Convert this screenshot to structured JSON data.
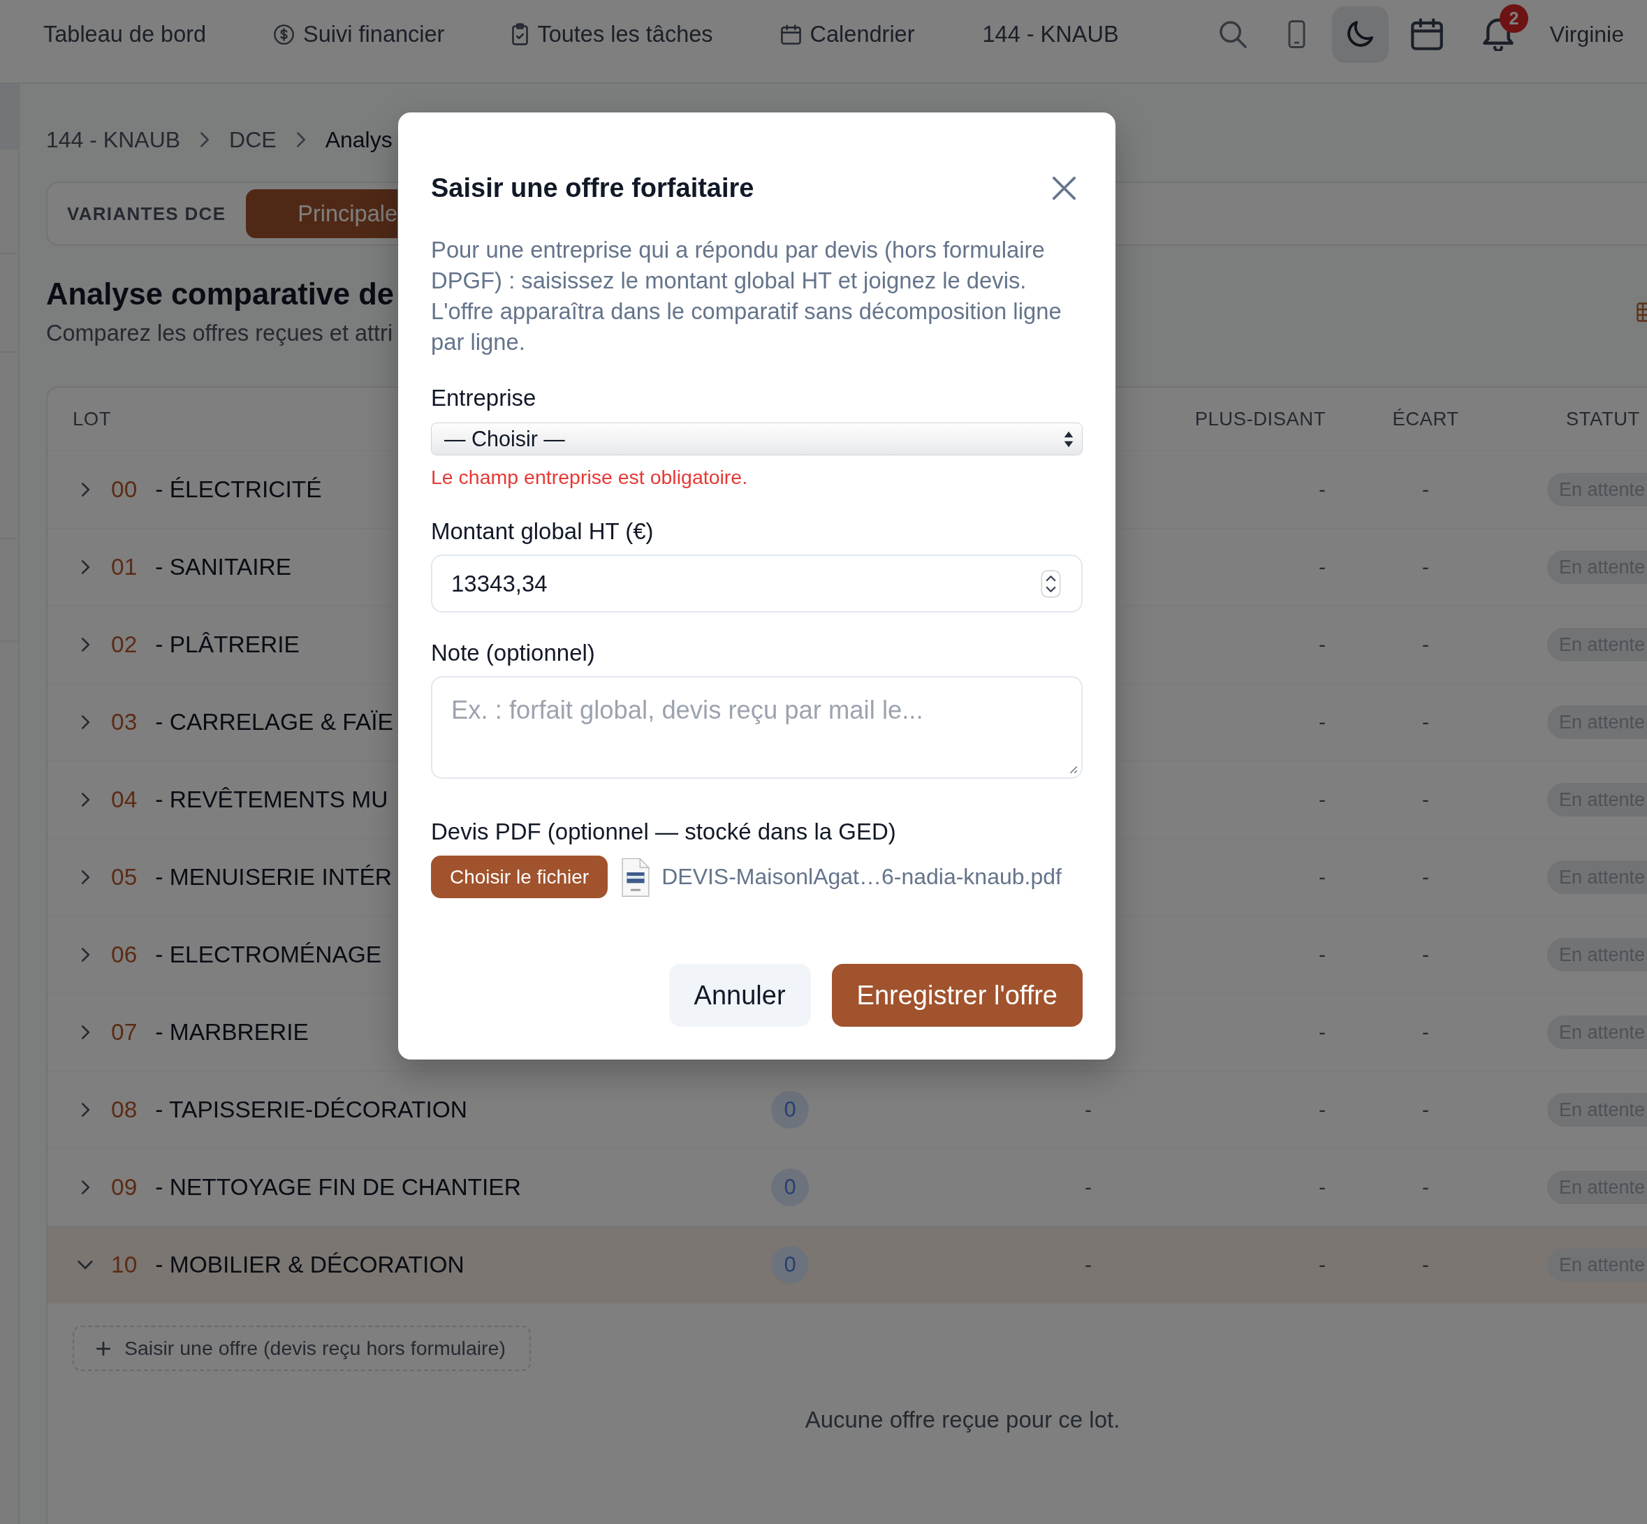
{
  "nav": {
    "home": "Tableau de bord",
    "finance": "Suivi financier",
    "tasks": "Toutes les tâches",
    "calendar": "Calendrier",
    "project": "144 - KNAUB"
  },
  "header_tools": {
    "theme_button": {
      "active": true
    },
    "notification_count": "2",
    "user_name": "Virginie"
  },
  "breadcrumb": [
    {
      "label": "144 - KNAUB",
      "current": false
    },
    {
      "label": "DCE",
      "current": false
    },
    {
      "label": "Analys",
      "current": true
    }
  ],
  "variants": {
    "label": "VARIANTES DCE",
    "tabs": [
      {
        "label": "Principale",
        "selected": true
      }
    ]
  },
  "page": {
    "title": "Analyse comparative de",
    "subtitle": "Comparez les offres reçues et attri"
  },
  "table": {
    "headers": {
      "lot": "LOT",
      "plus_disant": "PLUS-DISANT",
      "ecart": "ÉCART",
      "statut": "STATUT"
    },
    "rows": [
      {
        "number": "00",
        "name": "- ÉLECTRICITÉ",
        "expanded": false,
        "plus_disant": "-",
        "ecart": "-",
        "statut": "En attente"
      },
      {
        "number": "01",
        "name": "- SANITAIRE",
        "expanded": false,
        "plus_disant": "-",
        "ecart": "-",
        "statut": "En attente"
      },
      {
        "number": "02",
        "name": "- PLÂTRERIE",
        "expanded": false,
        "plus_disant": "-",
        "ecart": "-",
        "statut": "En attente"
      },
      {
        "number": "03",
        "name": "- CARRELAGE & FAÏE",
        "expanded": false,
        "plus_disant": "-",
        "ecart": "-",
        "statut": "En attente"
      },
      {
        "number": "04",
        "name": "- REVÊTEMENTS MU",
        "expanded": false,
        "plus_disant": "-",
        "ecart": "-",
        "statut": "En attente"
      },
      {
        "number": "05",
        "name": "- MENUISERIE INTÉR",
        "expanded": false,
        "plus_disant": "-",
        "ecart": "-",
        "statut": "En attente"
      },
      {
        "number": "06",
        "name": "- ELECTROMÉNAGE",
        "expanded": false,
        "plus_disant": "-",
        "ecart": "-",
        "statut": "En attente"
      },
      {
        "number": "07",
        "name": "- MARBRERIE",
        "expanded": false,
        "plus_disant": "-",
        "ecart": "-",
        "statut": "En attente"
      },
      {
        "number": "08",
        "name": "- TAPISSERIE-DÉCORATION",
        "expanded": false,
        "column_2": "0",
        "column_3": "-",
        "plus_disant": "-",
        "ecart": "-",
        "statut": "En attente"
      },
      {
        "number": "09",
        "name": "- NETTOYAGE FIN DE CHANTIER",
        "expanded": false,
        "column_2": "0",
        "column_3": "-",
        "plus_disant": "-",
        "ecart": "-",
        "statut": "En attente"
      },
      {
        "number": "10",
        "name": "- MOBILIER & DÉCORATION",
        "expanded": true,
        "column_2": "0",
        "column_3": "-",
        "plus_disant": "-",
        "ecart": "-",
        "statut": "En attente",
        "details": {
          "add_button": "Saisir une offre (devis reçu hors formulaire)",
          "empty_message": "Aucune offre reçue pour ce lot."
        }
      }
    ]
  },
  "modal": {
    "title": "Saisir une offre forfaitaire",
    "description": "Pour une entreprise qui a répondu par devis (hors formulaire DPGF) : saisissez le montant global HT et joignez le devis. L'offre apparaîtra dans le comparatif sans décomposition ligne par ligne.",
    "fields": [
      {
        "kind": "select",
        "label": "Entreprise",
        "value": "— Choisir —",
        "error": "Le champ entreprise est obligatoire."
      },
      {
        "kind": "number",
        "label": "Montant global HT (€)",
        "value": "13343,34"
      },
      {
        "kind": "textarea",
        "label": "Note (optionnel)",
        "placeholder": "Ex. : forfait global, devis reçu par mail le..."
      },
      {
        "kind": "file",
        "label": "Devis PDF (optionnel — stocké dans la GED)",
        "button": "Choisir le fichier",
        "file_name": "DEVIS-MaisonlAgat…6-nadia-knaub.pdf"
      }
    ],
    "buttons": [
      {
        "kind": "secondary",
        "label": "Annuler"
      },
      {
        "kind": "primary",
        "label": "Enregistrer l'offre"
      }
    ]
  }
}
